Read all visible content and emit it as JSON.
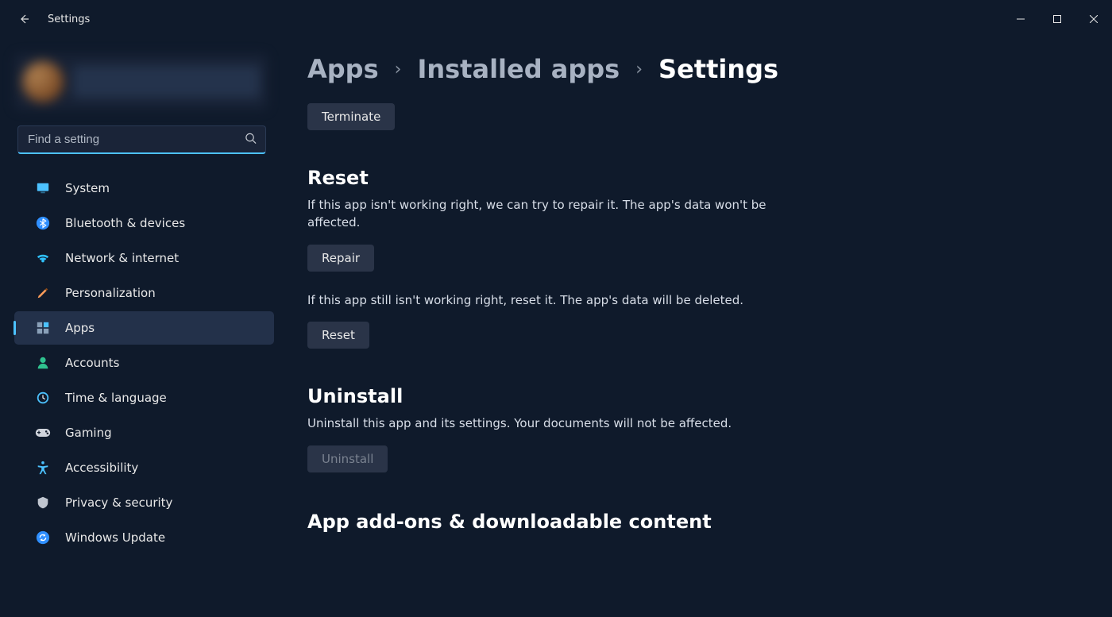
{
  "window": {
    "title": "Settings"
  },
  "search": {
    "placeholder": "Find a setting",
    "value": ""
  },
  "sidebar": {
    "items": [
      {
        "id": "system",
        "label": "System",
        "icon": "monitor-icon"
      },
      {
        "id": "bluetooth",
        "label": "Bluetooth & devices",
        "icon": "bluetooth-icon"
      },
      {
        "id": "network",
        "label": "Network & internet",
        "icon": "wifi-icon"
      },
      {
        "id": "personalization",
        "label": "Personalization",
        "icon": "paintbrush-icon"
      },
      {
        "id": "apps",
        "label": "Apps",
        "icon": "apps-icon",
        "active": true
      },
      {
        "id": "accounts",
        "label": "Accounts",
        "icon": "person-icon"
      },
      {
        "id": "time",
        "label": "Time & language",
        "icon": "clock-icon"
      },
      {
        "id": "gaming",
        "label": "Gaming",
        "icon": "gamepad-icon"
      },
      {
        "id": "accessibility",
        "label": "Accessibility",
        "icon": "accessibility-icon"
      },
      {
        "id": "privacy",
        "label": "Privacy & security",
        "icon": "shield-icon"
      },
      {
        "id": "update",
        "label": "Windows Update",
        "icon": "update-icon"
      }
    ]
  },
  "breadcrumb": {
    "parts": [
      "Apps",
      "Installed apps",
      "Settings"
    ]
  },
  "actions": {
    "terminate": "Terminate",
    "repair": "Repair",
    "reset": "Reset",
    "uninstall": "Uninstall"
  },
  "sections": {
    "reset": {
      "title": "Reset",
      "repair_desc": "If this app isn't working right, we can try to repair it. The app's data won't be affected.",
      "reset_desc": "If this app still isn't working right, reset it. The app's data will be deleted."
    },
    "uninstall": {
      "title": "Uninstall",
      "desc": "Uninstall this app and its settings. Your documents will not be affected."
    },
    "addons": {
      "title": "App add-ons & downloadable content"
    }
  }
}
